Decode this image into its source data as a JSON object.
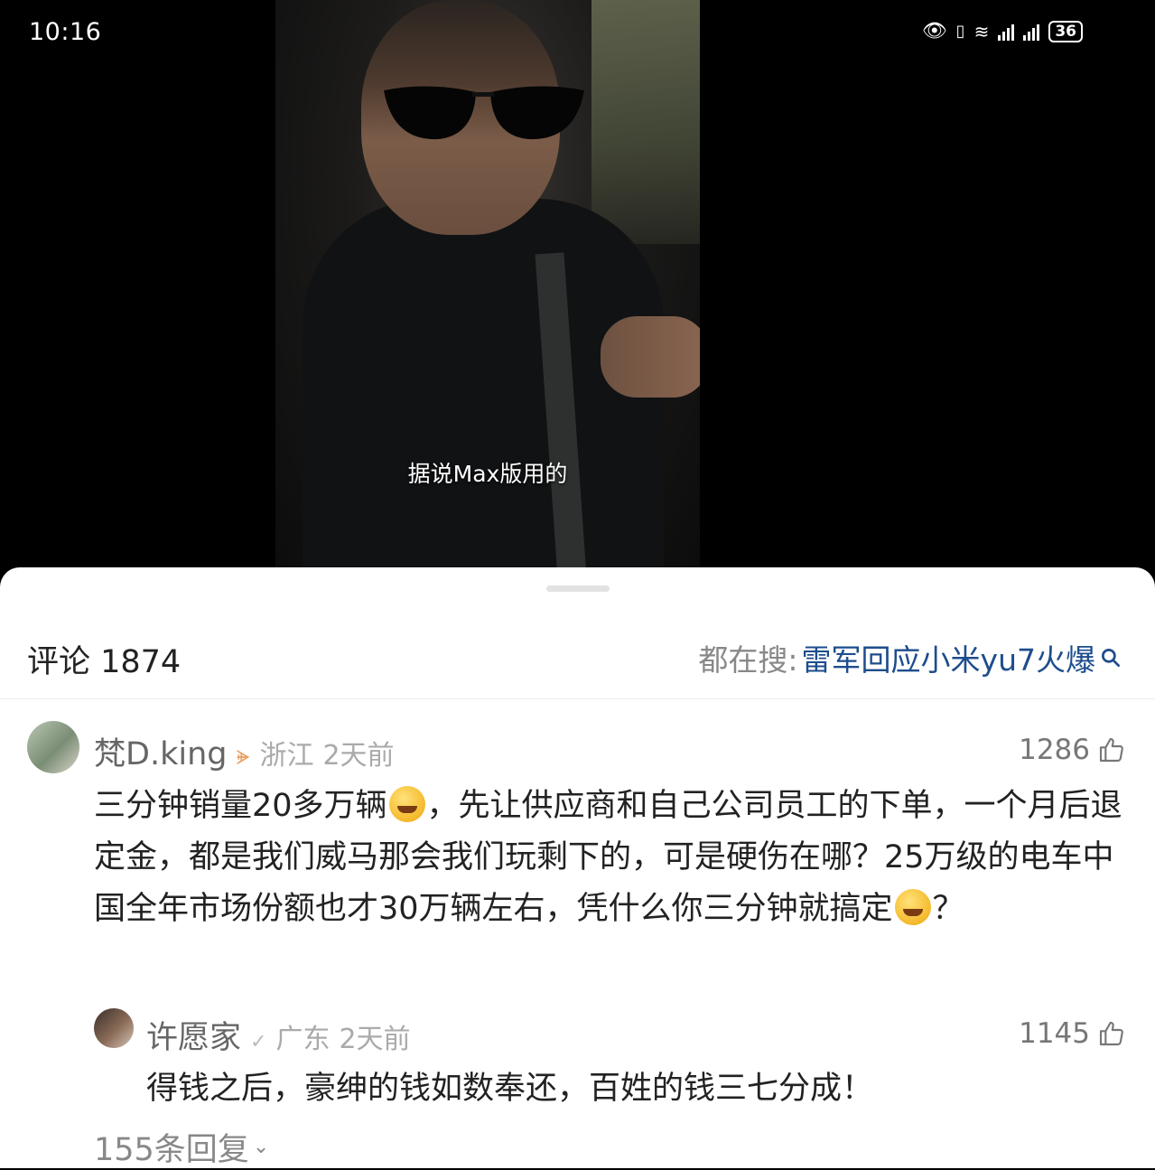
{
  "status_bar": {
    "time": "10:16",
    "battery": "36",
    "icons": [
      "eye-icon",
      "vibrate-icon",
      "wifi-icon",
      "signal-icon",
      "signal-icon",
      "battery-icon"
    ]
  },
  "video": {
    "caption": "据说Max版用的"
  },
  "comments": {
    "title": "评论 1874",
    "search_prefix": "都在搜:",
    "search_query": "雷军回应小米yu7火爆",
    "items": [
      {
        "username": "梵D.king",
        "location": "浙江",
        "time": "2天前",
        "likes": "1286",
        "text_parts": [
          "三分钟销量20多万辆",
          "，先让供应商和自己公司员工的下单，一个月后退定金，都是我们威马那会我们玩剩下的，可是硬伤在哪？25万级的电车中国全年市场份额也才30万辆左右，凭什么你三分钟就搞定",
          "？"
        ],
        "reply": {
          "username": "许愿家",
          "location": "广东",
          "time": "2天前",
          "likes": "1145",
          "text": "得钱之后，豪绅的钱如数奉还，百姓的钱三七分成！"
        },
        "more_replies": "155条回复"
      }
    ]
  },
  "colors": {
    "link": "#1d4d8c",
    "muted": "#888888",
    "badge": "#e9a46a"
  }
}
